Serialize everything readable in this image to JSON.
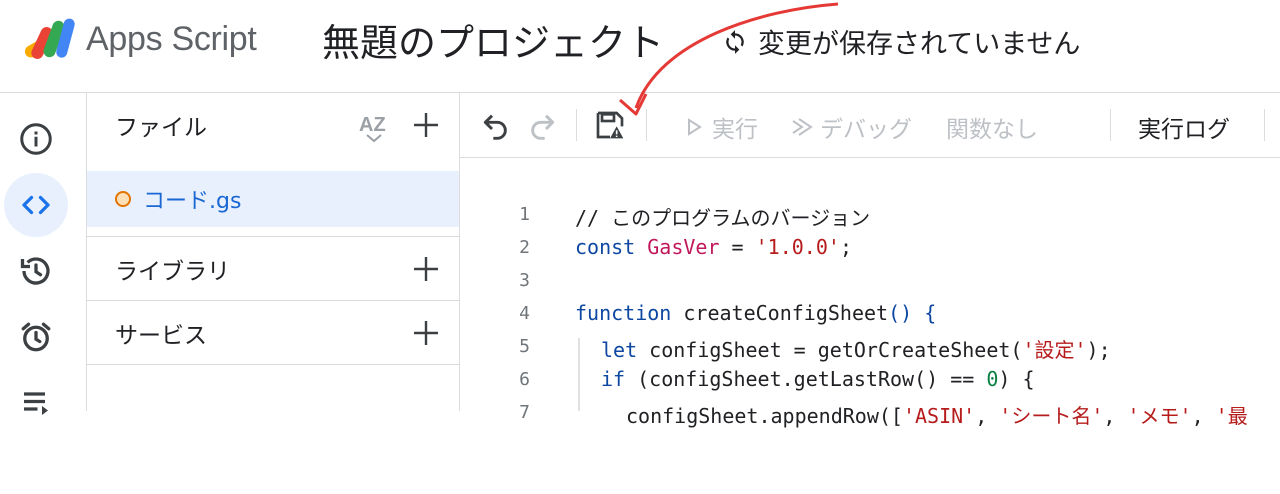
{
  "header": {
    "app_name": "Apps Script",
    "project_title": "無題のプロジェクト",
    "save_status": "変更が保存されていません"
  },
  "rail": {
    "items": [
      {
        "icon": "info-icon"
      },
      {
        "icon": "code-icon",
        "active": true
      },
      {
        "icon": "history-icon"
      },
      {
        "icon": "alarm-icon"
      },
      {
        "icon": "list-icon"
      }
    ]
  },
  "panel": {
    "files_label": "ファイル",
    "sort_label": "AZ",
    "file_name": "コード.gs",
    "libraries_label": "ライブラリ",
    "services_label": "サービス"
  },
  "toolbar": {
    "run_label": "実行",
    "debug_label": "デバッグ",
    "function_label": "関数なし",
    "log_label": "実行ログ"
  },
  "code": {
    "line_numbers": [
      "1",
      "2",
      "3",
      "4",
      "5",
      "6",
      "7"
    ],
    "comment": "// このプログラムのバージョン",
    "l2_kw": "const",
    "l2_var": "GasVer",
    "l2_op": " = ",
    "l2_str": "'1.0.0'",
    "l2_end": ";",
    "l4_kw": "function",
    "l4_fn": " createConfigSheet",
    "l4_paren": "() {",
    "l5_kw": "let",
    "l5_body": " configSheet = getOrCreateSheet(",
    "l5_str": "'設定'",
    "l5_end": ");",
    "l6_kw": "if",
    "l6_body": " (configSheet.getLastRow() == ",
    "l6_num": "0",
    "l6_end": ") {",
    "l7_body": "configSheet.appendRow([",
    "l7_s1": "'ASIN'",
    "l7_sep1": ", ",
    "l7_s2": "'シート名'",
    "l7_sep2": ", ",
    "l7_s3": "'メモ'",
    "l7_sep3": ", ",
    "l7_s4": "'最"
  },
  "colors": {
    "accent": "#1a73e8",
    "active_bg": "#e8f0fe",
    "annotation": "#e53935"
  }
}
